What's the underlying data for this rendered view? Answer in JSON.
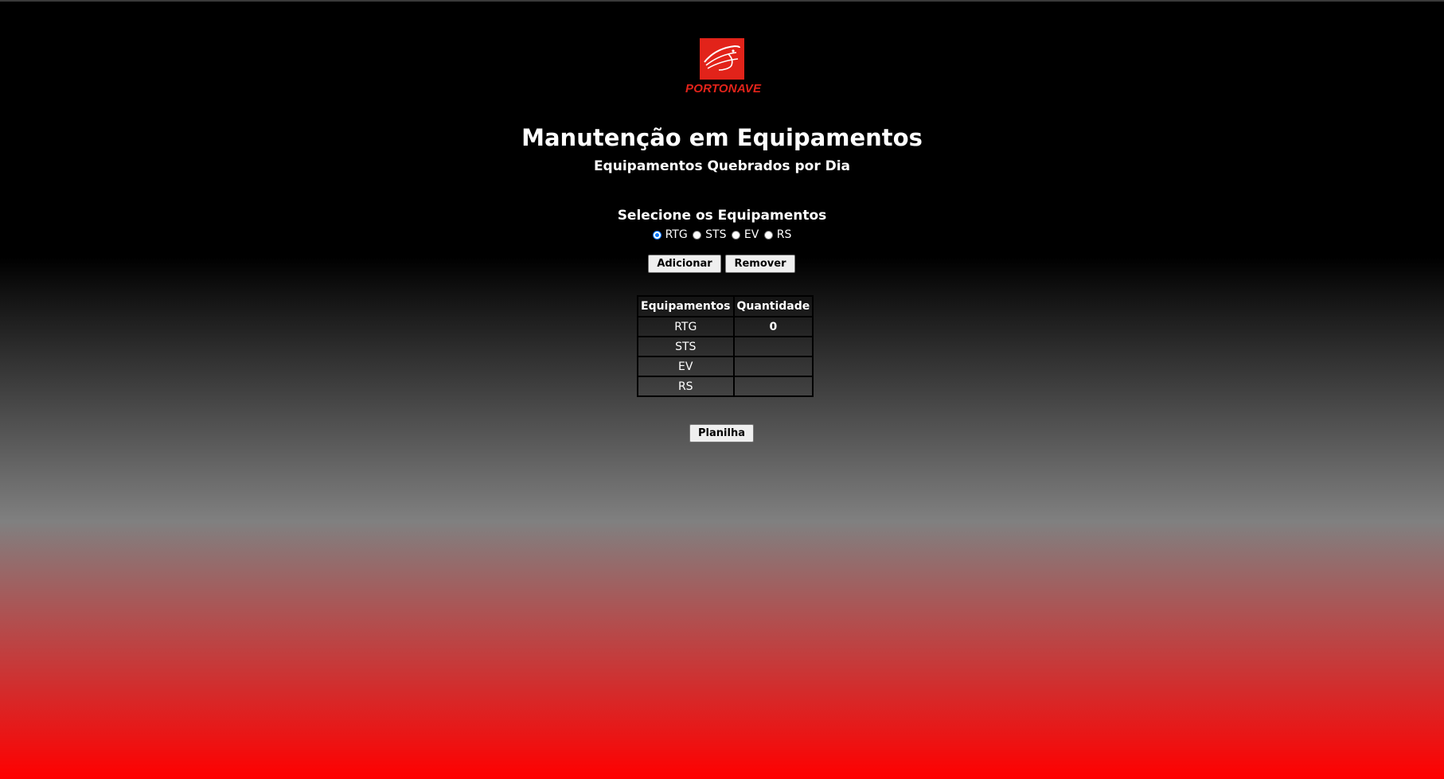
{
  "logo": {
    "text": "PORTONAVE",
    "icon": "ship-logo-icon",
    "color": "#e2231a"
  },
  "header": {
    "title": "Manutenção em Equipamentos",
    "subtitle": "Equipamentos Quebrados por Dia"
  },
  "selection": {
    "title": "Selecione os Equipamentos",
    "options": [
      {
        "label": "RTG",
        "checked": true
      },
      {
        "label": "STS",
        "checked": false
      },
      {
        "label": "EV",
        "checked": false
      },
      {
        "label": "RS",
        "checked": false
      }
    ]
  },
  "actions": {
    "add_label": "Adicionar",
    "remove_label": "Remover",
    "sheet_label": "Planilha"
  },
  "table": {
    "headers": [
      "Equipamentos",
      "Quantidade"
    ],
    "rows": [
      {
        "equipment": "RTG",
        "quantity": "0"
      },
      {
        "equipment": "STS",
        "quantity": ""
      },
      {
        "equipment": "EV",
        "quantity": ""
      },
      {
        "equipment": "RS",
        "quantity": ""
      }
    ]
  },
  "theme": {
    "gradient_top": "#000000",
    "gradient_mid": "#808080",
    "gradient_bottom": "#ff0000",
    "radio_accent": "#0075ff"
  }
}
